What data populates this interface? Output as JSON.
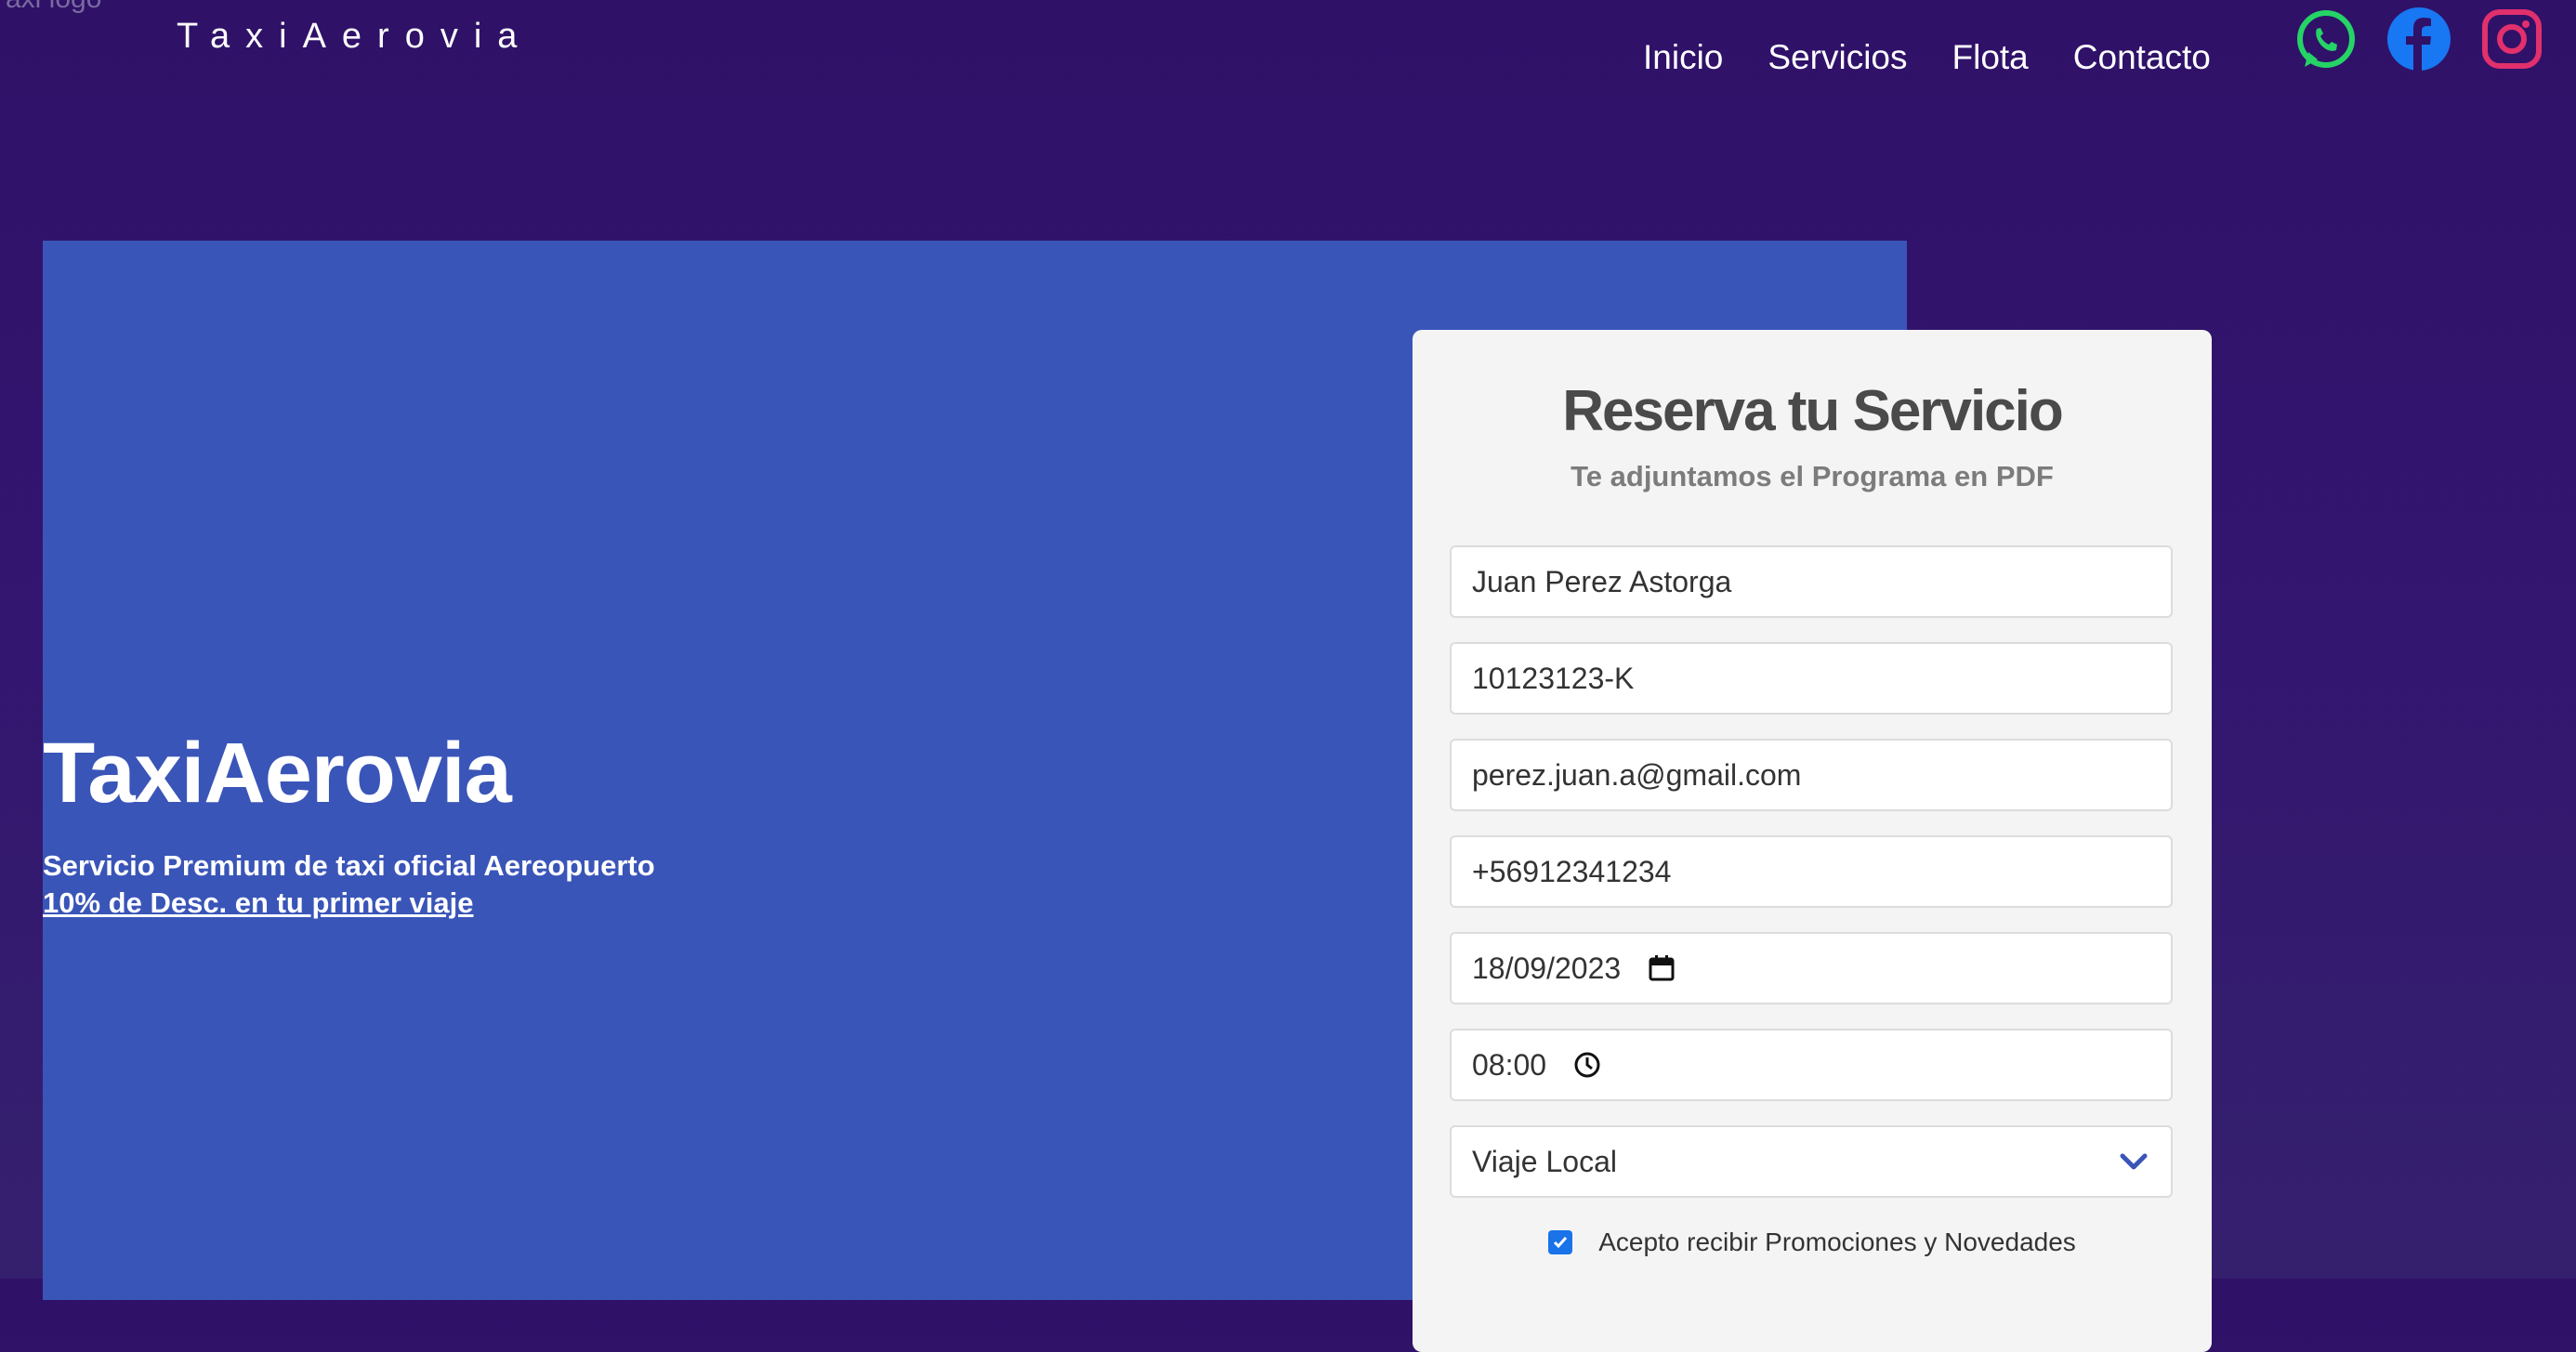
{
  "header": {
    "logo_alt": "axi logo",
    "brand": "TaxiAerovia",
    "nav": [
      "Inicio",
      "Servicios",
      "Flota",
      "Contacto"
    ],
    "social": [
      "whatsapp-icon",
      "facebook-icon",
      "instagram-icon"
    ]
  },
  "hero": {
    "title": "TaxiAerovia",
    "subtitle": "Servicio Premium de taxi oficial Aereopuerto",
    "offer": "10% de Desc. en tu primer viaje"
  },
  "form": {
    "title": "Reserva tu Servicio",
    "subtitle": "Te adjuntamos el Programa en PDF",
    "name": "Juan Perez Astorga",
    "rut": "10123123-K",
    "email": "perez.juan.a@gmail.com",
    "phone": "+56912341234",
    "date": "18/09/2023",
    "time": "08:00",
    "trip_type": "Viaje Local",
    "promo_label": "Acepto recibir Promociones y Novedades",
    "promo_checked": true
  },
  "colors": {
    "background": "#311466",
    "hero": "#3a55b8",
    "card": "#f4f4f4",
    "whatsapp": "#25d366",
    "facebook": "#1877f2",
    "instagram": "#e1306c"
  }
}
